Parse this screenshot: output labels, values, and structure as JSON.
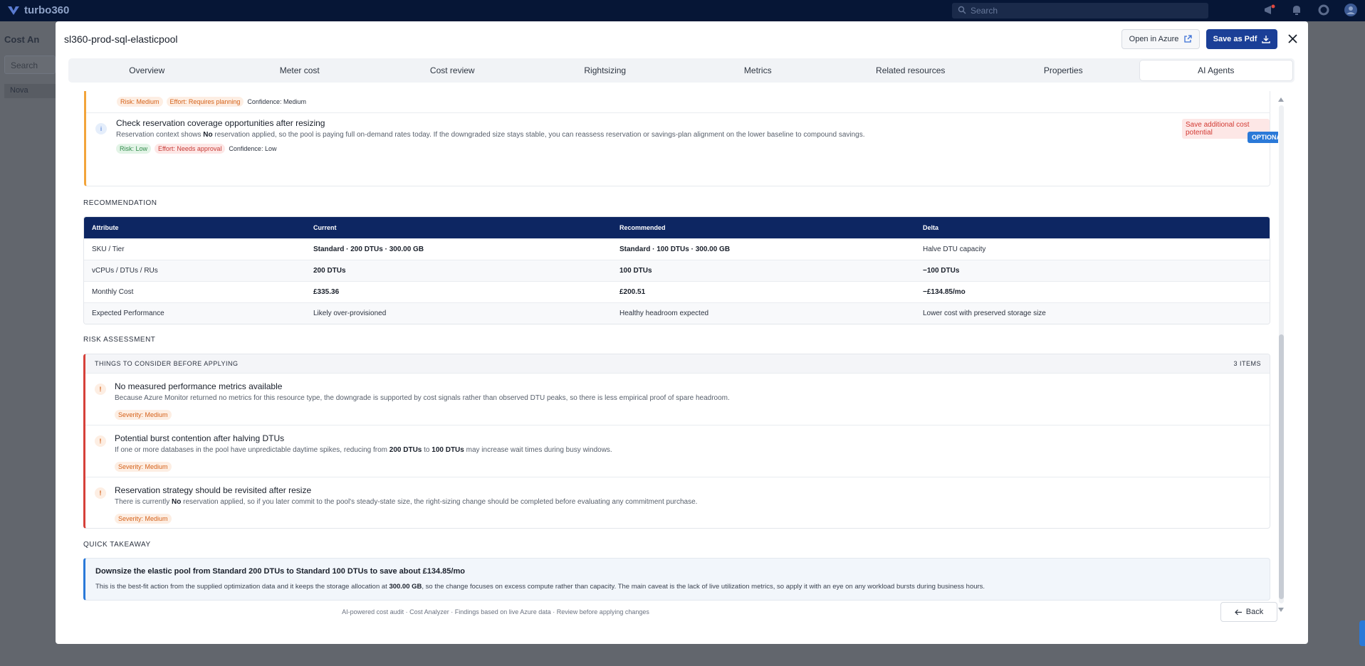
{
  "app": {
    "brand": "turbo360",
    "search_placeholder": "Search",
    "sidebar_title": "Cost An",
    "sidebar_search": "Search",
    "sidebar_row": "Nova"
  },
  "modal": {
    "title": "sl360-prod-sql-elasticpool",
    "open_azure_label": "Open in Azure",
    "save_pdf_label": "Save as Pdf",
    "tabs": [
      {
        "label": "Overview",
        "active": false
      },
      {
        "label": "Meter cost",
        "active": false
      },
      {
        "label": "Cost review",
        "active": false
      },
      {
        "label": "Rightsizing",
        "active": false
      },
      {
        "label": "Metrics",
        "active": false
      },
      {
        "label": "Related resources",
        "active": false
      },
      {
        "label": "Properties",
        "active": false
      },
      {
        "label": "AI Agents",
        "active": true
      }
    ]
  },
  "findings": {
    "top_pills": {
      "risk": "Risk: Medium",
      "effort": "Effort: Requires planning",
      "confidence": "Confidence: Medium"
    },
    "item": {
      "title": "Check reservation coverage opportunities after resizing",
      "desc_pre": "Reservation context shows ",
      "desc_bold": "No",
      "desc_post": " reservation applied, so the pool is paying full on-demand rates today. If the downgraded size stays stable, you can reassess reservation or savings-plan alignment on the lower baseline to compound savings.",
      "risk": "Risk: Low",
      "effort": "Effort: Needs approval",
      "confidence": "Confidence: Low",
      "save_tag": "Save additional cost potential",
      "optional_tag": "OPTIONAL"
    }
  },
  "recommendation": {
    "heading": "RECOMMENDATION",
    "headers": [
      "Attribute",
      "Current",
      "Recommended",
      "Delta"
    ],
    "rows": [
      [
        "SKU / Tier",
        "Standard · 200 DTUs · 300.00 GB",
        "Standard · 100 DTUs · 300.00 GB",
        "Halve DTU capacity"
      ],
      [
        "vCPUs / DTUs / RUs",
        "200 DTUs",
        "100 DTUs",
        "−100 DTUs"
      ],
      [
        "Monthly Cost",
        "£335.36",
        "£200.51",
        "−£134.85/mo"
      ],
      [
        "Expected Performance",
        "Likely over-provisioned",
        "Healthy headroom expected",
        "Lower cost with preserved storage size"
      ]
    ]
  },
  "risk": {
    "heading": "RISK ASSESSMENT",
    "box_title": "THINGS TO CONSIDER BEFORE APPLYING",
    "count": "3 ITEMS",
    "items": [
      {
        "title": "No measured performance metrics available",
        "desc": "Because Azure Monitor returned no metrics for this resource type, the downgrade is supported by cost signals rather than observed DTU peaks, so there is less empirical proof of spare headroom.",
        "severity": "Severity: Medium"
      },
      {
        "title": "Potential burst contention after halving DTUs",
        "desc_a": "If one or more databases in the pool have unpredictable daytime spikes, reducing from ",
        "desc_b1": "200 DTUs",
        "desc_c": " to ",
        "desc_b2": "100 DTUs",
        "desc_d": " may increase wait times during busy windows.",
        "severity": "Severity: Medium"
      },
      {
        "title": "Reservation strategy should be revisited after resize",
        "desc_a": "There is currently ",
        "desc_b": "No",
        "desc_c": " reservation applied, so if you later commit to the pool's steady-state size, the right-sizing change should be completed before evaluating any commitment purchase.",
        "severity": "Severity: Medium"
      }
    ]
  },
  "takeaway": {
    "heading": "QUICK TAKEAWAY",
    "title": "Downsize the elastic pool from Standard 200 DTUs to Standard 100 DTUs to save about £134.85/mo",
    "desc_a": "This is the best-fit action from the supplied optimization data and it keeps the storage allocation at ",
    "desc_b": "300.00 GB",
    "desc_c": ", so the change focuses on excess compute rather than capacity. The main caveat is the lack of live utilization metrics, so apply it with an eye on any workload bursts during business hours."
  },
  "footer": {
    "note": "AI-powered cost audit · Cost Analyzer · Findings based on live Azure data · Review before applying changes",
    "back_label": "Back"
  }
}
